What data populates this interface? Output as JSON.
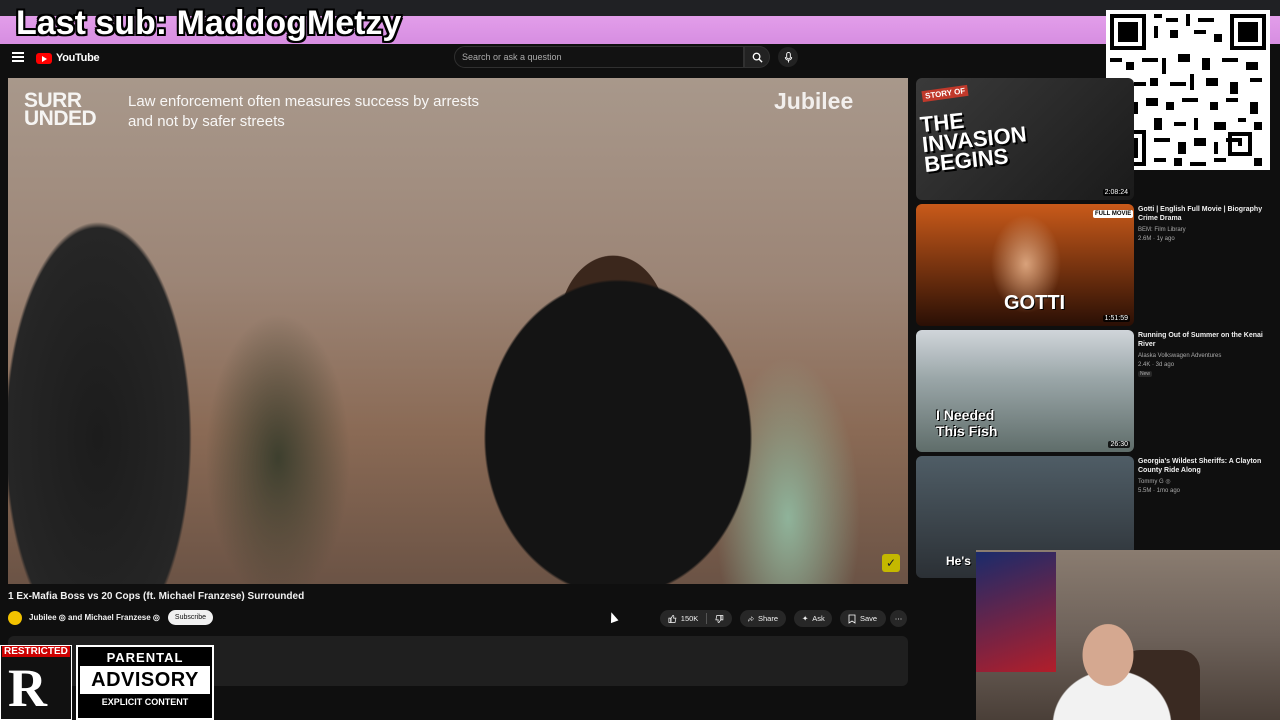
{
  "stream_banner": {
    "text": "Last sub: MaddogMetzy"
  },
  "header": {
    "logo_text": "YouTube",
    "search_placeholder": "Search or ask a question"
  },
  "video": {
    "overlay_logo_line1": "SURR",
    "overlay_logo_line2": "UNDED",
    "caption": "Law enforcement often measures success by arrests and not by safer streets",
    "watermark": "Jubilee",
    "title": "1 Ex-Mafia Boss vs 20 Cops (ft. Michael Franzese) Surrounded",
    "channel": "Jubilee ◎ and Michael Franzese ◎",
    "subscribe_label": "Subscribe",
    "like_count": "150K",
    "share_label": "Share",
    "ask_label": "Ask",
    "save_label": "Save"
  },
  "recommendations": [
    {
      "thumb_tag": "STORY OF",
      "thumb_text": "THE INVASION BEGINS",
      "duration": "2:08:24"
    },
    {
      "thumb_badge": "FULL MOVIE",
      "thumb_text": "GOTTI",
      "duration": "1:51:59",
      "title": "Gotti | English Full Movie | Biography Crime Drama",
      "channel": "BEM: Film Library",
      "meta": "2.6M · 1y ago"
    },
    {
      "thumb_text": "I Needed This Fish",
      "duration": "26:30",
      "title": "Running Out of Summer on the Kenai River",
      "channel": "Alaska Volkswagen Adventures",
      "meta": "2.4K · 3d ago",
      "badge": "New"
    },
    {
      "thumb_text": "He's",
      "title": "Georgia's Wildest Sheriffs: A Clayton County Ride Along",
      "channel": "Tommy G ◎",
      "meta": "5.5M · 1mo ago"
    }
  ],
  "overlays": {
    "rating_label": "RESTRICTED",
    "rating_letter": "R",
    "advisory_top": "PARENTAL",
    "advisory_mid": "ADVISORY",
    "advisory_bottom": "EXPLICIT CONTENT"
  },
  "colors": {
    "banner": "#d58be0",
    "youtube_red": "#ff0000",
    "background": "#0f0f0f"
  }
}
